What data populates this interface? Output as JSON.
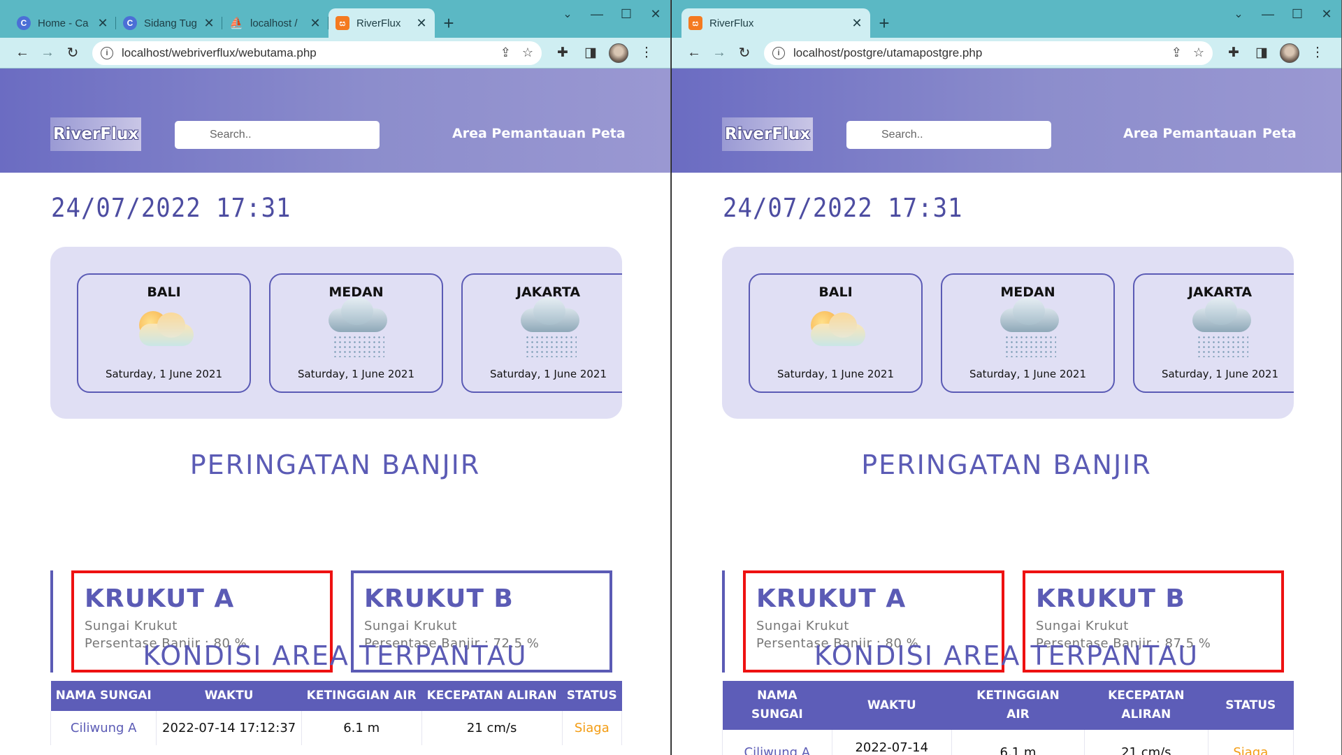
{
  "left": {
    "tabs": [
      {
        "label": "Home - Ca",
        "favicon": "canva-c-icon"
      },
      {
        "label": "Sidang Tug",
        "favicon": "canva-c-icon"
      },
      {
        "label": "localhost /",
        "favicon": "phpmyadmin-icon"
      },
      {
        "label": "RiverFlux",
        "favicon": "xampp-icon"
      }
    ],
    "url": "localhost/webriverflux/webutama.php",
    "page": {
      "logo": "RiverFlux",
      "search_placeholder": "Search..",
      "nav": [
        "Area Pemantauan",
        "Peta"
      ],
      "datetime": "24/07/2022 17:31",
      "weather": [
        {
          "city": "BALI",
          "date": "Saturday, 1 June 2021",
          "icon": "sunny-cloud-icon"
        },
        {
          "city": "MEDAN",
          "date": "Saturday, 1 June 2021",
          "icon": "rain-cloud-icon"
        },
        {
          "city": "JAKARTA",
          "date": "Saturday, 1 June 2021",
          "icon": "rain-cloud-icon"
        }
      ],
      "warning_title": "PERINGATAN BANJIR",
      "warnings": [
        {
          "name": "KRUKUT A",
          "river": "Sungai Krukut",
          "percent": "Persentase Banjir : 80 %",
          "alert": true
        },
        {
          "name": "KRUKUT B",
          "river": "Sungai Krukut",
          "percent": "Persentase Banjir : 72.5 %",
          "alert": false
        }
      ],
      "kondisi_title": "KONDISI AREA TERPANTAU",
      "table_headers": [
        "NAMA SUNGAI",
        "WAKTU",
        "KETINGGIAN AIR",
        "KECEPATAN ALIRAN",
        "STATUS"
      ],
      "table_rows": [
        {
          "river": "Ciliwung A",
          "time": "2022-07-14 17:12:37",
          "height": "6.1 m",
          "speed": "21 cm/s",
          "status": "Siaga"
        }
      ]
    }
  },
  "right": {
    "tabs": [
      {
        "label": "RiverFlux",
        "favicon": "xampp-icon"
      }
    ],
    "url": "localhost/postgre/utamapostgre.php",
    "page": {
      "logo": "RiverFlux",
      "search_placeholder": "Search..",
      "nav": [
        "Area Pemantauan",
        "Peta"
      ],
      "datetime": "24/07/2022 17:31",
      "weather": [
        {
          "city": "BALI",
          "date": "Saturday, 1 June 2021",
          "icon": "sunny-cloud-icon"
        },
        {
          "city": "MEDAN",
          "date": "Saturday, 1 June 2021",
          "icon": "rain-cloud-icon"
        },
        {
          "city": "JAKARTA",
          "date": "Saturday, 1 June 2021",
          "icon": "rain-cloud-icon"
        }
      ],
      "warning_title": "PERINGATAN BANJIR",
      "warnings": [
        {
          "name": "KRUKUT A",
          "river": "Sungai Krukut",
          "percent": "Persentase Banjir : 80 %",
          "alert": true
        },
        {
          "name": "KRUKUT B",
          "river": "Sungai Krukut",
          "percent": "Persentase Banjir : 87.5 %",
          "alert": true
        }
      ],
      "kondisi_title": "KONDISI AREA TERPANTAU",
      "table_headers_lines": [
        [
          "NAMA",
          "SUNGAI"
        ],
        [
          "WAKTU"
        ],
        [
          "KETINGGIAN",
          "AIR"
        ],
        [
          "KECEPATAN",
          "ALIRAN"
        ],
        [
          "STATUS"
        ]
      ],
      "table_rows": [
        {
          "river": "Ciliwung A",
          "time": "2022-07-14",
          "height": "6.1 m",
          "speed": "21 cm/s",
          "status": "Siaga"
        }
      ]
    }
  },
  "colors": {
    "accent": "#5b5bb5",
    "alert_border": "#ee1111",
    "status_siaga": "#f39c12",
    "tabstrip": "#5bb8c4"
  }
}
